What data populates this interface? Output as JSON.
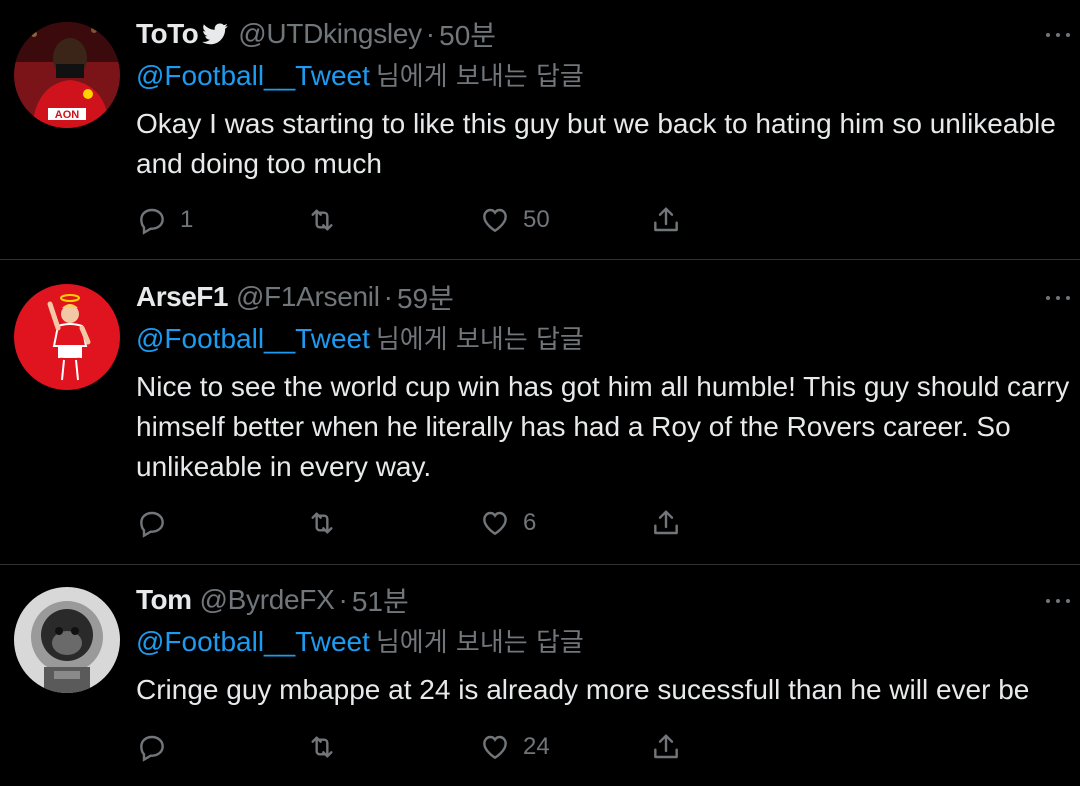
{
  "tweets": [
    {
      "name": "ToTo",
      "handle": "@UTDkingsley",
      "separator": "·",
      "time": "50분",
      "reply_mention": "@Football__Tweet",
      "reply_suffix": "님에게 보내는 답글",
      "text": "Okay I was starting to like this guy but we back to hating him so unlikeable and doing too much",
      "replies": "1",
      "retweets": "",
      "likes": "50",
      "avatar_icon": "player-red-jersey-avatar"
    },
    {
      "name": "ArseF1",
      "handle": "@F1Arsenil",
      "separator": "·",
      "time": "59분",
      "reply_mention": "@Football__Tweet",
      "reply_suffix": "님에게 보내는 답글",
      "text": "Nice to see the world cup win has got him all humble! This guy should carry himself better when he literally has had a Roy of the Rovers career. So unlikeable in every way.",
      "replies": "",
      "retweets": "",
      "likes": "6",
      "avatar_icon": "cartoon-player-halo-avatar"
    },
    {
      "name": "Tom",
      "handle": "@ByrdeFX",
      "separator": "·",
      "time": "51분",
      "reply_mention": "@Football__Tweet",
      "reply_suffix": "님에게 보내는 답글",
      "text": "Cringe guy mbappe at 24 is already more sucessfull than he will ever be",
      "replies": "",
      "retweets": "",
      "likes": "24",
      "avatar_icon": "monkey-astronaut-avatar"
    }
  ],
  "colors": {
    "background": "#000000",
    "text": "#e7e9ea",
    "muted": "#71767b",
    "link": "#1d9bf0",
    "divider": "#2f3336"
  }
}
